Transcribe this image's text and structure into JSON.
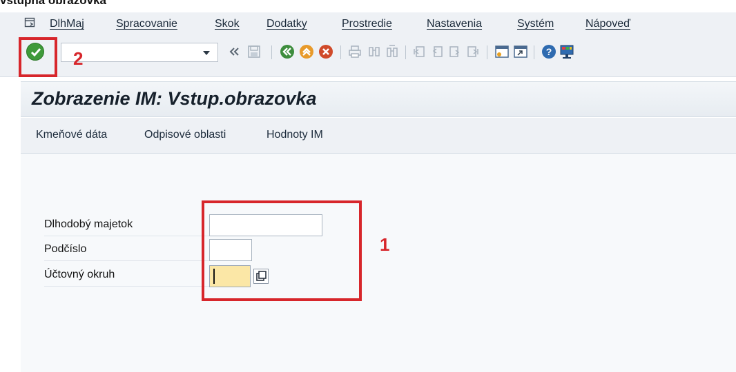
{
  "doc_caption": "vstupná obrazovka",
  "menu": {
    "items": [
      {
        "label": "DlhMaj"
      },
      {
        "label": "Spracovanie"
      },
      {
        "label": "Skok"
      },
      {
        "label": "Dodatky"
      },
      {
        "label": "Prostredie"
      },
      {
        "label": "Nastavenia"
      },
      {
        "label": "Systém"
      },
      {
        "label": "Nápoveď"
      }
    ]
  },
  "toolbar": {
    "command_field_value": "",
    "icons": [
      "check-circle-icon",
      "chevron-double-left-icon",
      "save-icon",
      "back-icon",
      "exit-icon",
      "cancel-icon",
      "print-icon",
      "find-icon",
      "find-next-icon",
      "first-page-icon",
      "previous-page-icon",
      "next-page-icon",
      "last-page-icon",
      "create-session-icon",
      "shortcut-icon",
      "help-icon",
      "customize-layout-icon"
    ]
  },
  "annotations": {
    "callout_1": "1",
    "callout_2": "2"
  },
  "title": "Zobrazenie IM: Vstup.obrazovka",
  "app_toolbar": {
    "buttons": [
      {
        "label": "Kmeňové dáta"
      },
      {
        "label": "Odpisové oblasti"
      },
      {
        "label": "Hodnoty IM"
      }
    ]
  },
  "form": {
    "fields": [
      {
        "label": "Dlhodobý majetok",
        "value": ""
      },
      {
        "label": "Podčíslo",
        "value": ""
      },
      {
        "label": "Účtovný okruh",
        "value": ""
      }
    ]
  },
  "colors": {
    "annotation_red": "#d7262b",
    "focused_field": "#fbe7a6",
    "ok_green": "#3f9a3a"
  }
}
